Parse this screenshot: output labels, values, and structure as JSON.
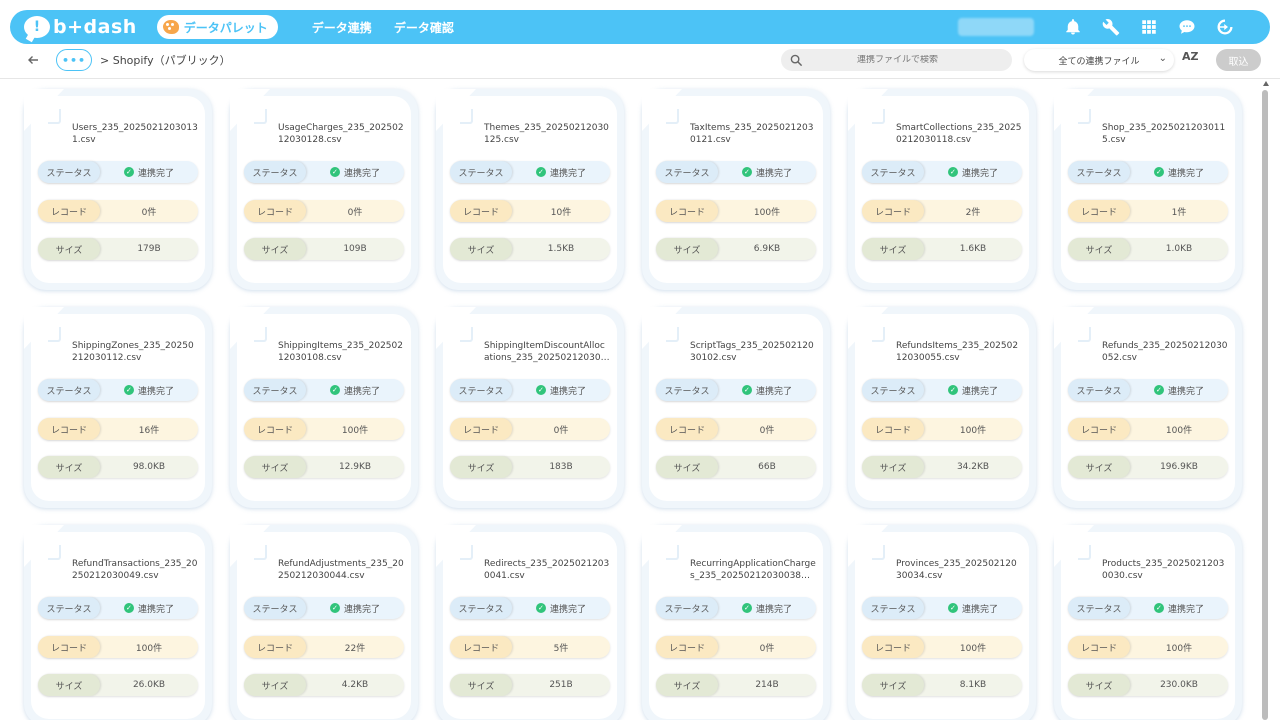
{
  "header": {
    "logo_text": "b+dash",
    "logo_mark": "!",
    "palette_label": "データパレット",
    "nav": [
      "データ連携",
      "データ確認"
    ],
    "icons": [
      "bell-icon",
      "wrench-icon",
      "grid-icon",
      "chat-icon",
      "logout-icon"
    ]
  },
  "toolbar": {
    "more_label": "•••",
    "breadcrumb": "> Shopify（パブリック）",
    "search_placeholder": "連携ファイルで検索",
    "filter_selected": "全ての連携ファイル",
    "sort_label": "AZ",
    "import_label": "取込"
  },
  "labels": {
    "status": "ステータス",
    "record": "レコード",
    "size": "サイズ"
  },
  "colors": {
    "accent": "#4cc3f6",
    "success": "#31c47b"
  },
  "files": [
    {
      "name": "Users_235_20250212030131.csv",
      "status": "連携完了",
      "records": "0件",
      "size": "179B"
    },
    {
      "name": "UsageCharges_235_20250212030128.csv",
      "status": "連携完了",
      "records": "0件",
      "size": "109B"
    },
    {
      "name": "Themes_235_20250212030125.csv",
      "status": "連携完了",
      "records": "10件",
      "size": "1.5KB"
    },
    {
      "name": "TaxItems_235_20250212030121.csv",
      "status": "連携完了",
      "records": "100件",
      "size": "6.9KB"
    },
    {
      "name": "SmartCollections_235_20250212030118.csv",
      "status": "連携完了",
      "records": "2件",
      "size": "1.6KB"
    },
    {
      "name": "Shop_235_20250212030115.csv",
      "status": "連携完了",
      "records": "1件",
      "size": "1.0KB"
    },
    {
      "name": "ShippingZones_235_20250212030112.csv",
      "status": "連携完了",
      "records": "16件",
      "size": "98.0KB"
    },
    {
      "name": "ShippingItems_235_20250212030108.csv",
      "status": "連携完了",
      "records": "100件",
      "size": "12.9KB"
    },
    {
      "name": "ShippingItemDiscountAllocations_235_20250212030…",
      "status": "連携完了",
      "records": "0件",
      "size": "183B"
    },
    {
      "name": "ScriptTags_235_20250212030102.csv",
      "status": "連携完了",
      "records": "0件",
      "size": "66B"
    },
    {
      "name": "RefundsItems_235_20250212030055.csv",
      "status": "連携完了",
      "records": "100件",
      "size": "34.2KB"
    },
    {
      "name": "Refunds_235_20250212030052.csv",
      "status": "連携完了",
      "records": "100件",
      "size": "196.9KB"
    },
    {
      "name": "RefundTransactions_235_20250212030049.csv",
      "status": "連携完了",
      "records": "100件",
      "size": "26.0KB"
    },
    {
      "name": "RefundAdjustments_235_20250212030044.csv",
      "status": "連携完了",
      "records": "22件",
      "size": "4.2KB"
    },
    {
      "name": "Redirects_235_20250212030041.csv",
      "status": "連携完了",
      "records": "5件",
      "size": "251B"
    },
    {
      "name": "RecurringApplicationCharges_235_20250212030038…",
      "status": "連携完了",
      "records": "0件",
      "size": "214B"
    },
    {
      "name": "Provinces_235_20250212030034.csv",
      "status": "連携完了",
      "records": "100件",
      "size": "8.1KB"
    },
    {
      "name": "Products_235_20250212030030.csv",
      "status": "連携完了",
      "records": "100件",
      "size": "230.0KB"
    }
  ]
}
